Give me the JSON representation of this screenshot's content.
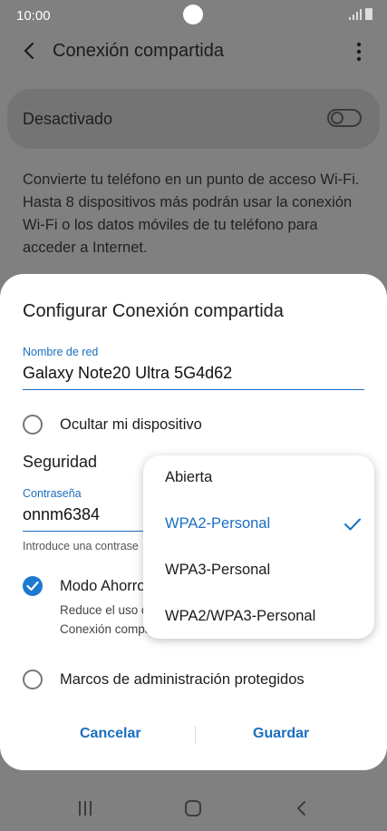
{
  "status": {
    "time": "10:00"
  },
  "app_bar": {
    "title": "Conexión compartida"
  },
  "toggle": {
    "label": "Desactivado"
  },
  "description": "Convierte tu teléfono en un punto de acceso Wi-Fi. Hasta 8 dispositivos más podrán usar la conexión Wi-Fi o los datos móviles de tu teléfono para acceder a Internet.",
  "dialog": {
    "title": "Configurar Conexión compartida",
    "network_name_label": "Nombre de red",
    "network_name_value": "Galaxy Note20 Ultra 5G4d62",
    "hide_device_label": "Ocultar mi dispositivo",
    "security_label": "Seguridad",
    "password_label": "Contraseña",
    "password_value": "onnm6384",
    "password_hint": "Introduce una contrase",
    "power_saving_label": "Modo Ahorro",
    "power_saving_desc_1": "Reduce el uso d",
    "power_saving_desc_2": "Conexión compa",
    "protected_frames_label": "Marcos de administración protegidos",
    "cancel_label": "Cancelar",
    "save_label": "Guardar"
  },
  "security_dropdown": {
    "options": [
      "Abierta",
      "WPA2-Personal",
      "WPA3-Personal",
      "WPA2/WPA3-Personal"
    ],
    "selected": "WPA2-Personal"
  },
  "colors": {
    "accent": "#1a6fbf",
    "checkbox_fill": "#1b7ad0",
    "scrim_background": "#808080",
    "dialog_background": "#ffffff"
  },
  "icons": [
    "back-arrow-icon",
    "more-vertical-icon",
    "signal-icon",
    "battery-icon",
    "check-icon",
    "recents-icon",
    "home-icon",
    "nav-back-icon"
  ]
}
